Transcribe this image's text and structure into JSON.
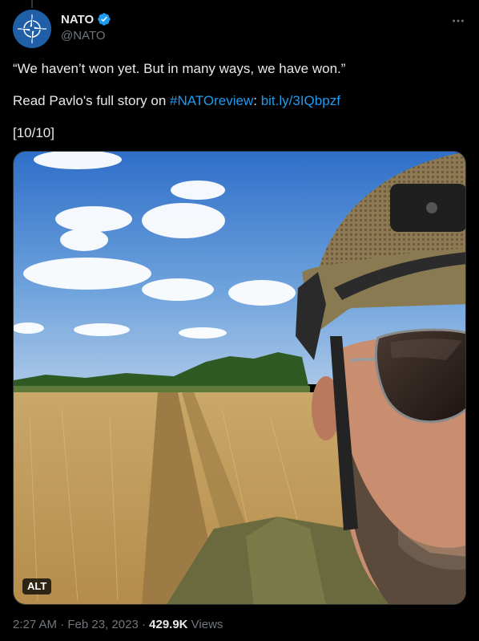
{
  "account": {
    "display_name": "NATO",
    "handle": "@NATO",
    "verified": true,
    "avatar_icon": "nato-compass-logo"
  },
  "tweet": {
    "quote": "“We haven’t won yet. But in many ways, we have won.”",
    "story_prefix": "Read Pavlo's full story on ",
    "hashtag": "#NATOreview",
    "separator": ": ",
    "link": "bit.ly/3IQbpzf",
    "counter": "[10/10]"
  },
  "media": {
    "alt_label": "ALT",
    "image_icon": "soldier-selfie-wheat-field-photo"
  },
  "meta": {
    "time": "2:27 AM",
    "dot1": " · ",
    "date": "Feb 23, 2023",
    "dot2": " · ",
    "views_count": "429.9K",
    "views_label": " Views"
  },
  "colors": {
    "background": "#000000",
    "text": "#e7e9ea",
    "secondary": "#71767b",
    "link": "#1d9bf0",
    "verified": "#1d9bf0"
  }
}
